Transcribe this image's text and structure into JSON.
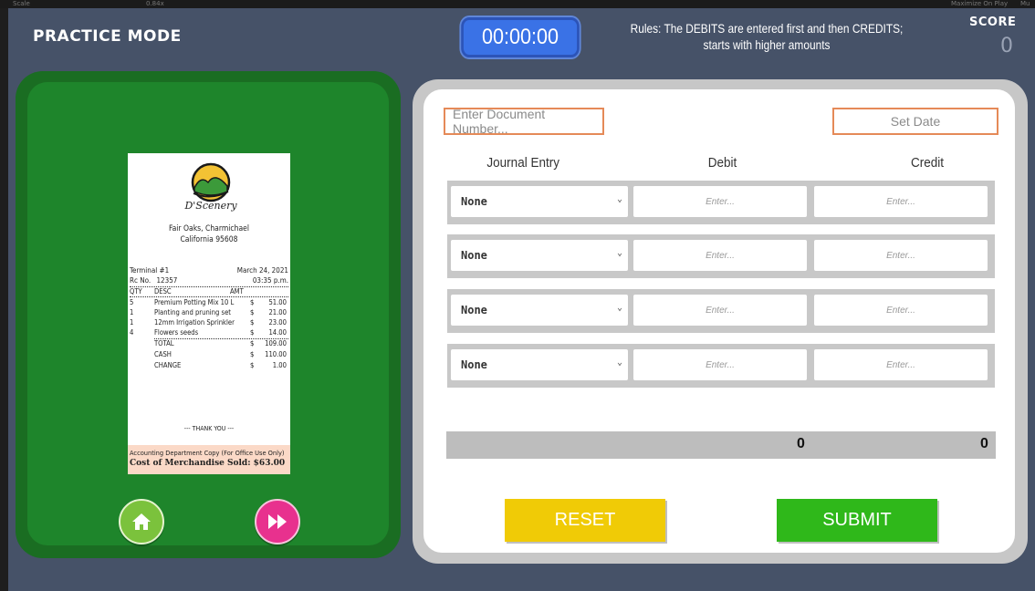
{
  "topbar": {
    "scale_label": "Scale",
    "scale_value": "0.84x",
    "maximize_label": "Maximize On Play",
    "right_label": "Mu"
  },
  "header": {
    "mode_title": "PRACTICE MODE",
    "timer": "00:00:00",
    "rules": "Rules: The DEBITS are entered first and then CREDITS; starts with higher amounts",
    "score_label": "SCORE",
    "score_value": "0"
  },
  "receipt": {
    "logo_text": "D'Scenery",
    "address_line1": "Fair Oaks, Charmichael",
    "address_line2": "California 95608",
    "terminal": "Terminal #1",
    "date": "March 24, 2021",
    "receipt_no_label": "Rc No.",
    "receipt_no": "12357",
    "time": "03:35 p.m.",
    "col_qty": "QTY",
    "col_desc": "DESC",
    "col_amt": "AMT",
    "items": [
      {
        "qty": "5",
        "desc": "Premium Potting Mix 10 L",
        "cur": "$",
        "amt": "51.00"
      },
      {
        "qty": "1",
        "desc": "Planting and pruning set",
        "cur": "$",
        "amt": "21.00"
      },
      {
        "qty": "1",
        "desc": "12mm Irrigation Sprinkler",
        "cur": "$",
        "amt": "23.00"
      },
      {
        "qty": "4",
        "desc": "Flowers seeds",
        "cur": "$",
        "amt": "14.00"
      }
    ],
    "total_label": "TOTAL",
    "total": "109.00",
    "cash_label": "CASH",
    "cash": "110.00",
    "change_label": "CHANGE",
    "change": "1.00",
    "currency": "$",
    "thanks": "--- THANK YOU ---",
    "copy_note": "Accounting Department Copy (For Office Use Only)",
    "cost_note": "Cost of Merchandise Sold: $63.00"
  },
  "form": {
    "doc_placeholder": "Enter Document Number...",
    "date_placeholder": "Set Date",
    "col_journal": "Journal Entry",
    "col_debit": "Debit",
    "col_credit": "Credit",
    "rows": [
      {
        "account": "None",
        "debit_placeholder": "Enter...",
        "credit_placeholder": "Enter..."
      },
      {
        "account": "None",
        "debit_placeholder": "Enter...",
        "credit_placeholder": "Enter..."
      },
      {
        "account": "None",
        "debit_placeholder": "Enter...",
        "credit_placeholder": "Enter..."
      },
      {
        "account": "None",
        "debit_placeholder": "Enter...",
        "credit_placeholder": "Enter..."
      }
    ],
    "total_debit": "0",
    "total_credit": "0",
    "reset_label": "RESET",
    "submit_label": "SUBMIT"
  },
  "colors": {
    "background": "#465268",
    "panel_green": "#1e852b",
    "timer_blue": "#3a72e6",
    "reset": "#f0cb06",
    "submit": "#2fb81a",
    "field_border": "#e58a58"
  }
}
